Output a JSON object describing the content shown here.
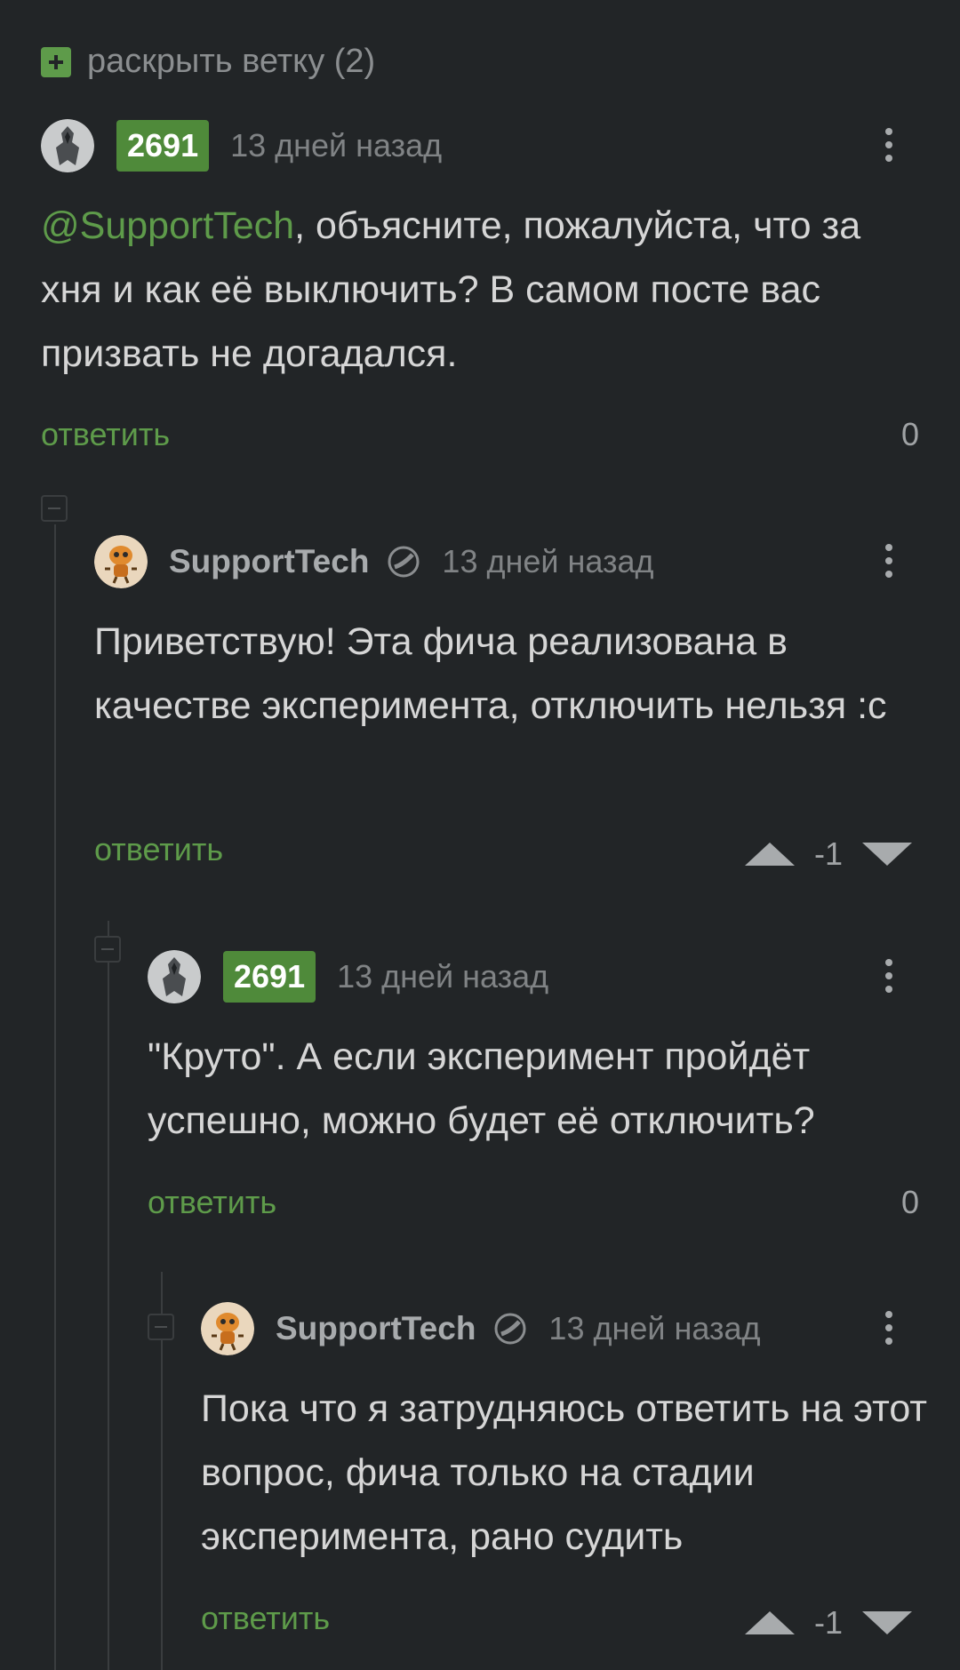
{
  "expand_branch": {
    "label": "раскрыть ветку (2)"
  },
  "comments": [
    {
      "rating": "2691",
      "time": "13 дней назад",
      "mention": "@SupportTech",
      "text": ", объясните, пожалуйста, что за хня и как её выключить? В самом посте вас призвать не догадался.",
      "reply": "ответить",
      "score": "0"
    },
    {
      "author": "SupportTech",
      "time": "13 дней назад",
      "text": "Приветствую! Эта фича реализована в качестве эксперимента, отключить нельзя :с",
      "reply": "ответить",
      "score": "-1"
    },
    {
      "rating": "2691",
      "time": "13 дней назад",
      "text": "\"Круто\". А если эксперимент пройдёт успешно, можно будет её отключить?",
      "reply": "ответить",
      "score": "0"
    },
    {
      "author": "SupportTech",
      "time": "13 дней назад",
      "text": "Пока что я затрудняюсь ответить на этот вопрос, фича только на стадии эксперимента, рано судить",
      "reply": "ответить",
      "score": "-1"
    }
  ],
  "icons": {
    "expand": "plus-square-icon",
    "menu": "more-vertical-icon",
    "badge": "official-badge-icon",
    "vote_up": "triangle-up-icon",
    "vote_down": "triangle-down-icon",
    "collapse": "minus-square-icon"
  },
  "colors": {
    "background": "#222527",
    "accent_green": "#5e9b4a",
    "rating_bg": "#4f8a3a"
  }
}
